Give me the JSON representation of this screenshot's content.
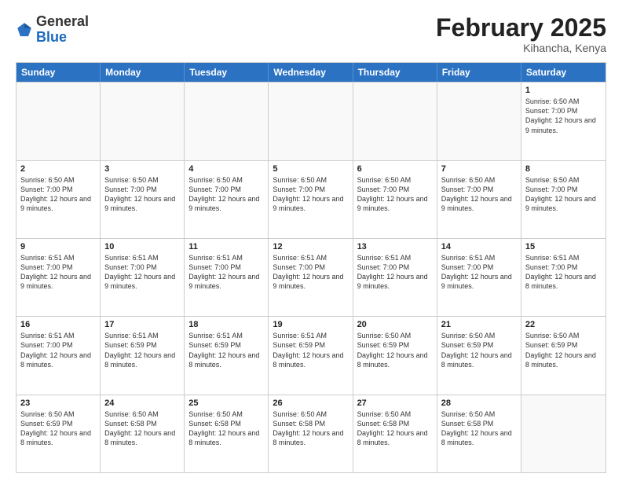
{
  "logo": {
    "general": "General",
    "blue": "Blue"
  },
  "title": "February 2025",
  "location": "Kihancha, Kenya",
  "days_of_week": [
    "Sunday",
    "Monday",
    "Tuesday",
    "Wednesday",
    "Thursday",
    "Friday",
    "Saturday"
  ],
  "weeks": [
    [
      {
        "day": "",
        "empty": true
      },
      {
        "day": "",
        "empty": true
      },
      {
        "day": "",
        "empty": true
      },
      {
        "day": "",
        "empty": true
      },
      {
        "day": "",
        "empty": true
      },
      {
        "day": "",
        "empty": true
      },
      {
        "day": "1",
        "sunrise": "Sunrise: 6:50 AM",
        "sunset": "Sunset: 7:00 PM",
        "daylight": "Daylight: 12 hours and 9 minutes."
      }
    ],
    [
      {
        "day": "2",
        "sunrise": "Sunrise: 6:50 AM",
        "sunset": "Sunset: 7:00 PM",
        "daylight": "Daylight: 12 hours and 9 minutes."
      },
      {
        "day": "3",
        "sunrise": "Sunrise: 6:50 AM",
        "sunset": "Sunset: 7:00 PM",
        "daylight": "Daylight: 12 hours and 9 minutes."
      },
      {
        "day": "4",
        "sunrise": "Sunrise: 6:50 AM",
        "sunset": "Sunset: 7:00 PM",
        "daylight": "Daylight: 12 hours and 9 minutes."
      },
      {
        "day": "5",
        "sunrise": "Sunrise: 6:50 AM",
        "sunset": "Sunset: 7:00 PM",
        "daylight": "Daylight: 12 hours and 9 minutes."
      },
      {
        "day": "6",
        "sunrise": "Sunrise: 6:50 AM",
        "sunset": "Sunset: 7:00 PM",
        "daylight": "Daylight: 12 hours and 9 minutes."
      },
      {
        "day": "7",
        "sunrise": "Sunrise: 6:50 AM",
        "sunset": "Sunset: 7:00 PM",
        "daylight": "Daylight: 12 hours and 9 minutes."
      },
      {
        "day": "8",
        "sunrise": "Sunrise: 6:50 AM",
        "sunset": "Sunset: 7:00 PM",
        "daylight": "Daylight: 12 hours and 9 minutes."
      }
    ],
    [
      {
        "day": "9",
        "sunrise": "Sunrise: 6:51 AM",
        "sunset": "Sunset: 7:00 PM",
        "daylight": "Daylight: 12 hours and 9 minutes."
      },
      {
        "day": "10",
        "sunrise": "Sunrise: 6:51 AM",
        "sunset": "Sunset: 7:00 PM",
        "daylight": "Daylight: 12 hours and 9 minutes."
      },
      {
        "day": "11",
        "sunrise": "Sunrise: 6:51 AM",
        "sunset": "Sunset: 7:00 PM",
        "daylight": "Daylight: 12 hours and 9 minutes."
      },
      {
        "day": "12",
        "sunrise": "Sunrise: 6:51 AM",
        "sunset": "Sunset: 7:00 PM",
        "daylight": "Daylight: 12 hours and 9 minutes."
      },
      {
        "day": "13",
        "sunrise": "Sunrise: 6:51 AM",
        "sunset": "Sunset: 7:00 PM",
        "daylight": "Daylight: 12 hours and 9 minutes."
      },
      {
        "day": "14",
        "sunrise": "Sunrise: 6:51 AM",
        "sunset": "Sunset: 7:00 PM",
        "daylight": "Daylight: 12 hours and 9 minutes."
      },
      {
        "day": "15",
        "sunrise": "Sunrise: 6:51 AM",
        "sunset": "Sunset: 7:00 PM",
        "daylight": "Daylight: 12 hours and 8 minutes."
      }
    ],
    [
      {
        "day": "16",
        "sunrise": "Sunrise: 6:51 AM",
        "sunset": "Sunset: 7:00 PM",
        "daylight": "Daylight: 12 hours and 8 minutes."
      },
      {
        "day": "17",
        "sunrise": "Sunrise: 6:51 AM",
        "sunset": "Sunset: 6:59 PM",
        "daylight": "Daylight: 12 hours and 8 minutes."
      },
      {
        "day": "18",
        "sunrise": "Sunrise: 6:51 AM",
        "sunset": "Sunset: 6:59 PM",
        "daylight": "Daylight: 12 hours and 8 minutes."
      },
      {
        "day": "19",
        "sunrise": "Sunrise: 6:51 AM",
        "sunset": "Sunset: 6:59 PM",
        "daylight": "Daylight: 12 hours and 8 minutes."
      },
      {
        "day": "20",
        "sunrise": "Sunrise: 6:50 AM",
        "sunset": "Sunset: 6:59 PM",
        "daylight": "Daylight: 12 hours and 8 minutes."
      },
      {
        "day": "21",
        "sunrise": "Sunrise: 6:50 AM",
        "sunset": "Sunset: 6:59 PM",
        "daylight": "Daylight: 12 hours and 8 minutes."
      },
      {
        "day": "22",
        "sunrise": "Sunrise: 6:50 AM",
        "sunset": "Sunset: 6:59 PM",
        "daylight": "Daylight: 12 hours and 8 minutes."
      }
    ],
    [
      {
        "day": "23",
        "sunrise": "Sunrise: 6:50 AM",
        "sunset": "Sunset: 6:59 PM",
        "daylight": "Daylight: 12 hours and 8 minutes."
      },
      {
        "day": "24",
        "sunrise": "Sunrise: 6:50 AM",
        "sunset": "Sunset: 6:58 PM",
        "daylight": "Daylight: 12 hours and 8 minutes."
      },
      {
        "day": "25",
        "sunrise": "Sunrise: 6:50 AM",
        "sunset": "Sunset: 6:58 PM",
        "daylight": "Daylight: 12 hours and 8 minutes."
      },
      {
        "day": "26",
        "sunrise": "Sunrise: 6:50 AM",
        "sunset": "Sunset: 6:58 PM",
        "daylight": "Daylight: 12 hours and 8 minutes."
      },
      {
        "day": "27",
        "sunrise": "Sunrise: 6:50 AM",
        "sunset": "Sunset: 6:58 PM",
        "daylight": "Daylight: 12 hours and 8 minutes."
      },
      {
        "day": "28",
        "sunrise": "Sunrise: 6:50 AM",
        "sunset": "Sunset: 6:58 PM",
        "daylight": "Daylight: 12 hours and 8 minutes."
      },
      {
        "day": "",
        "empty": true
      }
    ]
  ]
}
